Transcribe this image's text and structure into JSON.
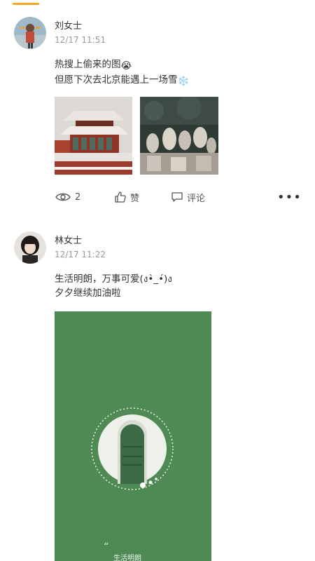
{
  "colors": {
    "accent": "#f5a623",
    "orange_button": "#f7a51c",
    "timestamp": "#999999",
    "divider": "#f2f2f2",
    "green_card": "#4f8a55"
  },
  "posts": [
    {
      "username": "刘女士",
      "timestamp": "12/17 11:51",
      "text_line1": "热搜上偷来的图",
      "text_line1_emoji": "😭",
      "text_line2": "但愿下次去北京能遇上一场雪",
      "text_line2_emoji": "❄️",
      "images": [
        "palace-in-snow",
        "stone-statues-in-snow"
      ],
      "views": "2",
      "like_label": "赞",
      "comment_label": "评论",
      "more_label": "•••"
    },
    {
      "username": "林女士",
      "timestamp": "12/17 11:22",
      "text_line1": "生活明朗，万事可爱(ง•̀_•́)ง",
      "text_line2": "夕夕继续加油啦",
      "image_caption": "生活明朗"
    }
  ]
}
